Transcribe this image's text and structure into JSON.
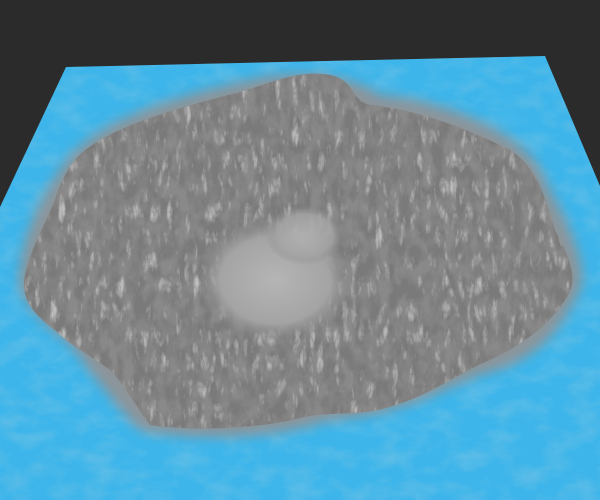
{
  "scene": {
    "subject": "terrain",
    "colors": {
      "background": "#2b2b2b",
      "ocean": "#3db5ea",
      "ocean_shallow": "#49c3f2",
      "ocean_shadow": "#2a8fc2",
      "shelf": "#8c949a",
      "terrain_mid": "#7a7a7a",
      "terrain_light": "#b4b4b4",
      "terrain_dark": "#3e3e3e",
      "crater_floor": "#a8a8a8"
    }
  }
}
